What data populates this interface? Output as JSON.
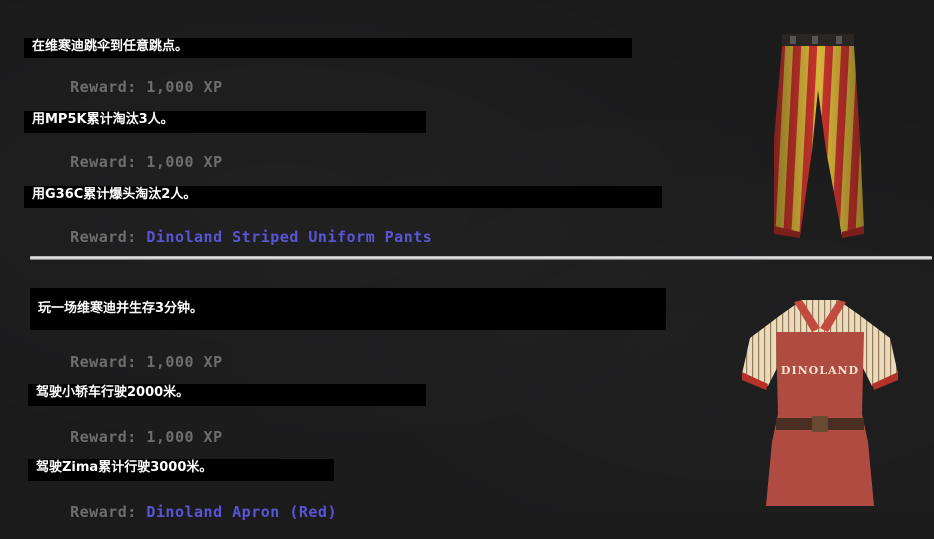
{
  "sections": [
    {
      "missions": [
        {
          "task": "在维寒迪跳伞到任意跳点。",
          "reward_label": "Reward:",
          "reward_value": "1,000 XP"
        },
        {
          "task": "用MP5K累计淘汰3人。",
          "reward_label": "Reward:",
          "reward_value": "1,000 XP"
        },
        {
          "task": "用G36C累计爆头淘汰2人。",
          "reward_label": "Reward:",
          "reward_value": "Dinoland Striped Uniform Pants"
        }
      ],
      "item_icon": "striped-pants-icon"
    },
    {
      "missions": [
        {
          "task": "玩一场维寒迪并生存3分钟。",
          "reward_label": "Reward:",
          "reward_value": "1,000 XP"
        },
        {
          "task": "驾驶小轿车行驶2000米。",
          "reward_label": "Reward:",
          "reward_value": "1,000 XP"
        },
        {
          "task": "驾驶Zima累计行驶3000米。",
          "reward_label": "Reward:",
          "reward_value": "Dinoland Apron (Red)"
        }
      ],
      "item_icon": "apron-shirt-icon",
      "apron_text": "DINOLAND"
    }
  ],
  "colors": {
    "background": "#1b1b1c",
    "reward_gray": "#6e6e6e",
    "reward_item": "#5a55d6",
    "task_text": "#ffffff"
  }
}
